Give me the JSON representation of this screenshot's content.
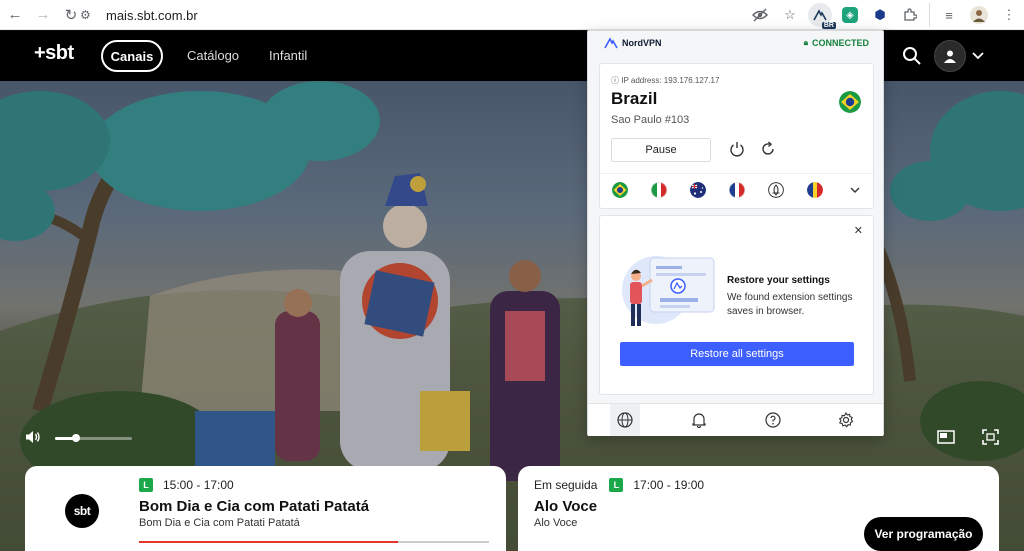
{
  "browser": {
    "url": "mais.sbt.com.br",
    "extension_badge": "BR"
  },
  "site": {
    "logo": "+sbt",
    "nav": [
      {
        "label": "Canais",
        "active": true
      },
      {
        "label": "Catálogo"
      },
      {
        "label": "Infantil"
      }
    ]
  },
  "player": {
    "volume_level": 0.27
  },
  "now_playing": {
    "logo": "sbt",
    "rating": "L",
    "time": "15:00 - 17:00",
    "title": "Bom Dia e Cia com Patati Patatá",
    "subtitle": "Bom Dia e Cia com Patati Patatá",
    "progress": 0.74
  },
  "next_up": {
    "label": "Em seguida",
    "rating": "L",
    "time": "17:00 - 19:00",
    "title": "Alo Voce",
    "subtitle": "Alo Voce",
    "button_label": "Ver programação"
  },
  "nordvpn": {
    "brand": "NordVPN",
    "status": "CONNECTED",
    "ip_label": "IP address: 193.176.127.17",
    "country": "Brazil",
    "server": "Sao Paulo #103",
    "pause_label": "Pause",
    "quick_flags": [
      "brazil-flag-icon",
      "italy-flag-icon",
      "australia-flag-icon",
      "france-flag-icon",
      "onion-icon",
      "romania-flag-icon"
    ],
    "restore": {
      "title": "Restore your settings",
      "text": "We found extension settings saves in browser.",
      "button": "Restore all settings"
    },
    "bottom_tabs": [
      "globe-icon",
      "bell-icon",
      "help-icon",
      "gear-icon"
    ],
    "colors": {
      "connected": "#16803c",
      "primary": "#3e5fff"
    }
  }
}
